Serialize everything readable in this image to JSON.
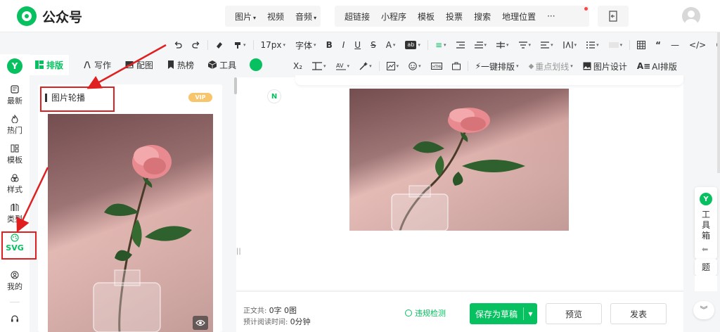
{
  "brand": {
    "name": "公众号",
    "color": "#07c160"
  },
  "top_menu": {
    "group1": [
      {
        "label": "图片",
        "has_dropdown": true
      },
      {
        "label": "视频",
        "has_dropdown": false
      },
      {
        "label": "音频",
        "has_dropdown": true
      }
    ],
    "group2": [
      "超链接",
      "小程序",
      "模板",
      "投票",
      "搜索",
      "地理位置"
    ],
    "more": "···"
  },
  "toolbar_row1": {
    "font_size": "17px",
    "font_family": "字体",
    "items": [
      "B",
      "I",
      "U",
      "S",
      "A",
      "ab",
      "≡",
      "≣",
      "“",
      "—",
      "</>",
      "☺"
    ]
  },
  "toolbar_row2": {
    "subscript": "X₂",
    "one_click_layout": "一键排版",
    "highlight_line": "重点划线",
    "image_design": "图片设计",
    "ai_layout": "AI排版"
  },
  "panel_tabs": [
    {
      "label": "排版",
      "active": true,
      "icon": "layout-icon"
    },
    {
      "label": "写作",
      "active": false,
      "icon": "pen-icon"
    },
    {
      "label": "配图",
      "active": false,
      "icon": "image-icon"
    },
    {
      "label": "热榜",
      "active": false,
      "icon": "bookmark-icon"
    },
    {
      "label": "工具",
      "active": false,
      "icon": "cube-icon"
    }
  ],
  "rail": {
    "logo": "Y",
    "items": [
      {
        "label": "最新",
        "icon": "news-icon",
        "active": false
      },
      {
        "label": "热门",
        "icon": "fire-icon",
        "active": false
      },
      {
        "label": "模板",
        "icon": "template-icon",
        "active": false
      },
      {
        "label": "样式",
        "icon": "style-icon",
        "active": false
      },
      {
        "label": "类型",
        "icon": "type-icon",
        "active": false
      },
      {
        "label": "SVG",
        "icon": "svg-icon",
        "active": true
      },
      {
        "label": "我的",
        "icon": "user-icon",
        "active": false
      }
    ]
  },
  "panel": {
    "title": "图片轮播",
    "badge": "VIP"
  },
  "canvas": {
    "mini_logo": "N",
    "drag_mark": "||"
  },
  "bottom": {
    "word_count_label": "正文共:",
    "word_count_value": "0字 0图",
    "read_time_label": "预计阅读时间:",
    "read_time_value": "0分钟",
    "violation_check": "违规检测",
    "save_draft": "保存为草稿",
    "preview": "预览",
    "publish": "发表"
  },
  "side_tools": {
    "logo": "Y",
    "label": "工具箱",
    "title_fragment": "题"
  },
  "colors": {
    "accent": "#07c160",
    "annotation": "#e02020",
    "vip": "#f7c56b"
  }
}
